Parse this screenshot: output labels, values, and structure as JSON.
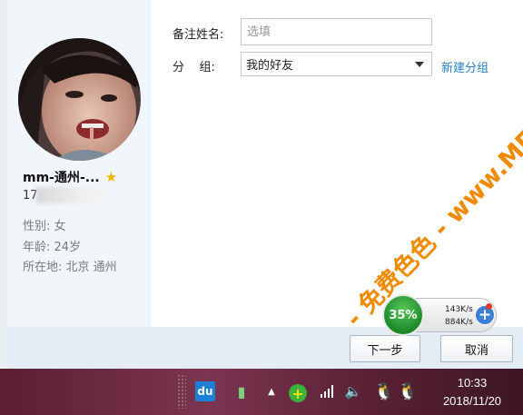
{
  "contact": {
    "nickname": "mm-通州-...",
    "account_prefix": "17",
    "gender_label": "性别:",
    "gender": "女",
    "age_label": "年龄:",
    "age": "24岁",
    "location_label": "所在地:",
    "location": "北京  通州"
  },
  "form": {
    "remark_label": "备注姓名:",
    "remark_placeholder": "选填",
    "group_label": "分    组:",
    "group_value": "我的好友",
    "new_group_link": "新建分组"
  },
  "buttons": {
    "next": "下一步",
    "cancel": "取消"
  },
  "speed_widget": {
    "percent": "35%",
    "up": "143K/s",
    "down": "884K/s"
  },
  "watermark": "- 免费色色 - www.MFsese.com",
  "taskbar": {
    "du_icon_text": "du",
    "time": "10:33",
    "date": "2018/11/20"
  },
  "colors": {
    "link": "#2a7fc1",
    "left_panel": "#f1f6fb",
    "footer": "#e4edf5",
    "speed_green": "#1d8a2a",
    "star": "#f2b400",
    "watermark": "#f08a00"
  }
}
